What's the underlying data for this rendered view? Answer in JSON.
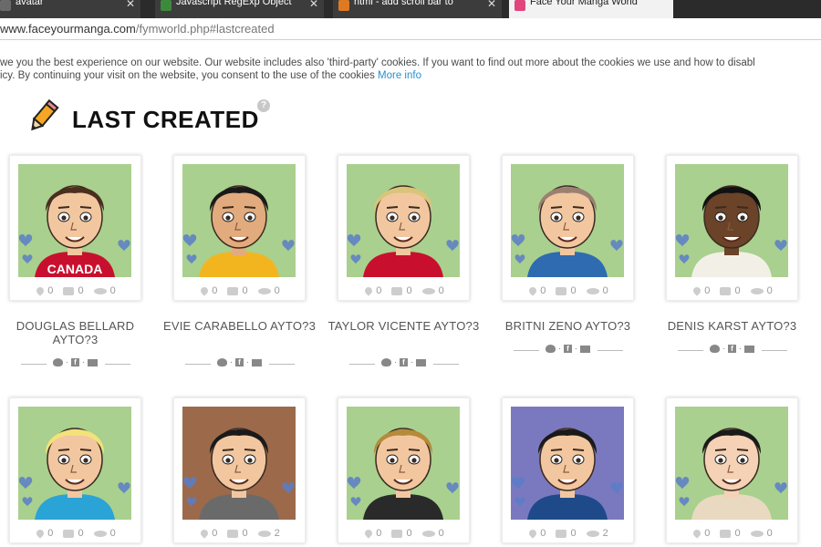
{
  "browser": {
    "tabs": [
      {
        "label": "avatar",
        "icon_color": "#6a6a6a"
      },
      {
        "label": "Javascript RegExp Object",
        "icon_color": "#3d8a3d"
      },
      {
        "label": "html - add scroll bar to",
        "icon_color": "#e07a22"
      },
      {
        "label": "Face Your Manga World",
        "icon_color": "#e0457b"
      }
    ],
    "url_host": "www.faceyourmanga.com",
    "url_path": "/fymworld.php#lastcreated"
  },
  "cookie": {
    "line1": "we you the best experience on our website. Our website includes also 'third-party' cookies. If you want to find out more about the cookies we use and how to disabl",
    "line2": "icy. By continuing your visit on the website, you consent to the use of the cookies",
    "more_info": "More info"
  },
  "section": {
    "title": "LAST CREATED",
    "help": "?"
  },
  "avatars": [
    {
      "name": "DOUGLAS BELLARD AYTO?3",
      "likes": "0",
      "comments": "0",
      "views": "0"
    },
    {
      "name": "EVIE CARABELLO AYTO?3",
      "likes": "0",
      "comments": "0",
      "views": "0"
    },
    {
      "name": "TAYLOR VICENTE AYTO?3",
      "likes": "0",
      "comments": "0",
      "views": "0"
    },
    {
      "name": "BRITNI ZENO AYTO?3",
      "likes": "0",
      "comments": "0",
      "views": "0"
    },
    {
      "name": "DENIS KARST AYTO?3",
      "likes": "0",
      "comments": "0",
      "views": "0"
    },
    {
      "name": "",
      "likes": "0",
      "comments": "0",
      "views": "0"
    },
    {
      "name": "",
      "likes": "0",
      "comments": "0",
      "views": "2"
    },
    {
      "name": "",
      "likes": "0",
      "comments": "0",
      "views": "0"
    },
    {
      "name": "",
      "likes": "0",
      "comments": "0",
      "views": "2"
    },
    {
      "name": "",
      "likes": "0",
      "comments": "0",
      "views": "0"
    }
  ],
  "avatar_art": [
    {
      "bg": "#a9d08e",
      "skin": "#f2c7a0",
      "hair": "#4a2e1e",
      "shirt": "#c8102e",
      "shirt_text": "CANADA"
    },
    {
      "bg": "#a9d08e",
      "skin": "#e2ab7d",
      "hair": "#1a1a1a",
      "shirt": "#f3b51f",
      "shirt_text": ""
    },
    {
      "bg": "#a9d08e",
      "skin": "#f2c7a0",
      "hair": "#d9c47a",
      "shirt": "#c8102e",
      "shirt_text": ""
    },
    {
      "bg": "#a9d08e",
      "skin": "#f2c7a0",
      "hair": "#9a8070",
      "shirt": "#2f6bb0",
      "shirt_text": ""
    },
    {
      "bg": "#a9d08e",
      "skin": "#6b4329",
      "hair": "#111111",
      "shirt": "#f2f0e6",
      "shirt_text": ""
    },
    {
      "bg": "#a9d08e",
      "skin": "#f2c7a0",
      "hair": "#f3e27a",
      "shirt": "#2aa3d6",
      "shirt_text": ""
    },
    {
      "bg": "#9c6a4a",
      "skin": "#f2c7a0",
      "hair": "#1a1a1a",
      "shirt": "#6a6a6a",
      "shirt_text": ""
    },
    {
      "bg": "#a9d08e",
      "skin": "#f2c7a0",
      "hair": "#b58a3a",
      "shirt": "#2a2a2a",
      "shirt_text": ""
    },
    {
      "bg": "#7a79c0",
      "skin": "#f2c7a0",
      "hair": "#1a1a1a",
      "shirt": "#1f4a8a",
      "shirt_text": ""
    },
    {
      "bg": "#a9d08e",
      "skin": "#f5d2b5",
      "hair": "#1a1a1a",
      "shirt": "#e9d9c0",
      "shirt_text": ""
    }
  ]
}
